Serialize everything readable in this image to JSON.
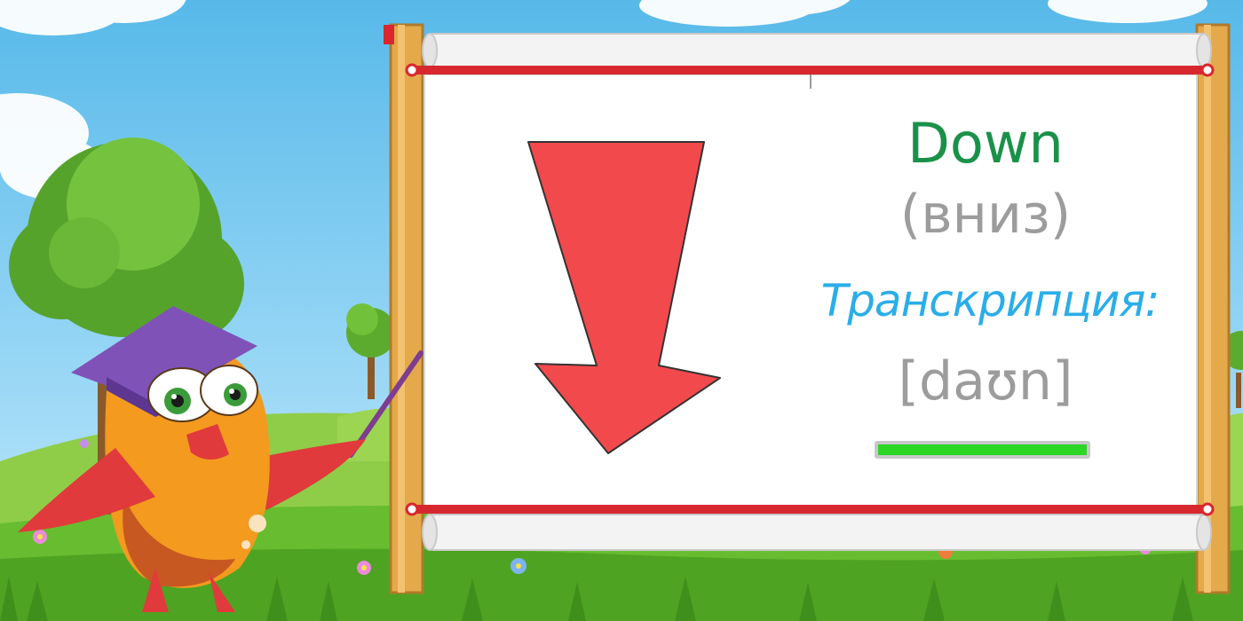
{
  "board": {
    "word": "Down",
    "translation": "(вниз)",
    "transcription_label": "Транскрипция:",
    "transcription": "[daʊn]"
  },
  "progress": {
    "value": 1.0
  },
  "colors": {
    "sky": "#57b9e9",
    "grass": "#67bd2f",
    "arrow": "#f2494d",
    "word": "#1a9149",
    "translation": "#9c9c9c",
    "transcription_label": "#2aaee9",
    "progress_fill": "#2bd625",
    "rail": "#d7282f"
  },
  "icons": {
    "arrow": "down-arrow-icon",
    "mascot": "owl-teacher-mascot"
  }
}
